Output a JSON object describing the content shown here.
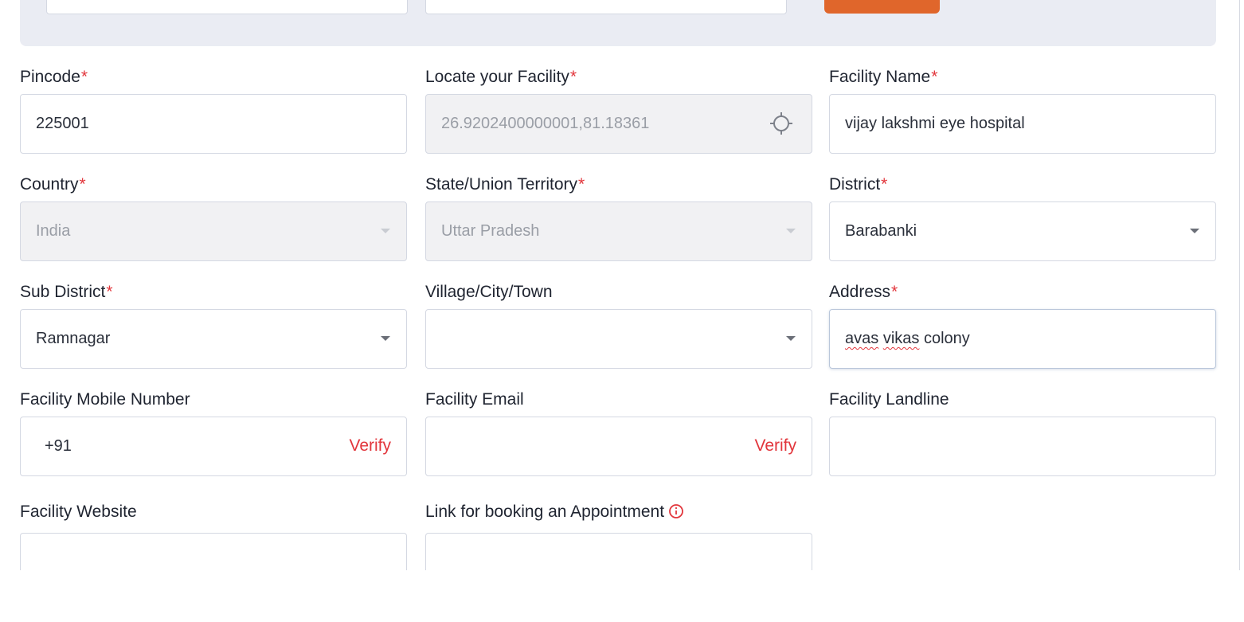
{
  "form": {
    "pincode": {
      "label": "Pincode",
      "required_mark": "*",
      "value": "225001"
    },
    "locate": {
      "label": "Locate your Facility",
      "required_mark": "*",
      "value": "26.9202400000001,81.18361",
      "icon": "crosshair-icon"
    },
    "facility_name": {
      "label": "Facility Name",
      "required_mark": "*",
      "value": "vijay lakshmi eye hospital"
    },
    "country": {
      "label": "Country",
      "required_mark": "*",
      "value": "India"
    },
    "state": {
      "label": "State/Union Territory",
      "required_mark": "*",
      "value": "Uttar Pradesh"
    },
    "district": {
      "label": "District",
      "required_mark": "*",
      "value": "Barabanki"
    },
    "sub_district": {
      "label": "Sub District",
      "required_mark": "*",
      "value": "Ramnagar"
    },
    "village": {
      "label": "Village/City/Town",
      "value": ""
    },
    "address": {
      "label": "Address",
      "required_mark": "*",
      "value_part1": "avas",
      "value_part2": "vikas",
      "value_part3": "colony"
    },
    "mobile": {
      "label": "Facility Mobile Number",
      "prefix": "+91",
      "verify_label": "Verify"
    },
    "email": {
      "label": "Facility Email",
      "verify_label": "Verify"
    },
    "landline": {
      "label": "Facility Landline"
    },
    "website": {
      "label": "Facility Website"
    },
    "appointment": {
      "label": "Link for booking an Appointment",
      "icon": "info-icon"
    }
  },
  "colors": {
    "accent": "#e0662b",
    "required": "#e2363c",
    "panel": "#eaecf3"
  }
}
